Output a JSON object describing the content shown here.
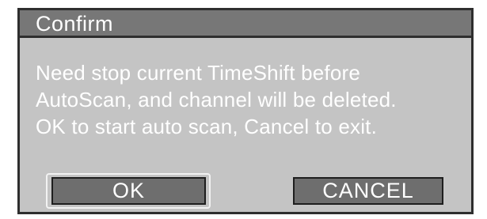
{
  "dialog": {
    "title": "Confirm",
    "message_lines": [
      "Need stop current TimeShift before",
      "AutoScan, and channel will be deleted.",
      "OK to start auto scan, Cancel to exit."
    ],
    "buttons": {
      "ok_label": "OK",
      "cancel_label": "CANCEL",
      "focused": "OK"
    }
  },
  "colors": {
    "background": "#c4c4c4",
    "titlebar": "#777777",
    "button": "#6e6e6e",
    "text": "#ffffff",
    "border": "#2e2e2e"
  }
}
